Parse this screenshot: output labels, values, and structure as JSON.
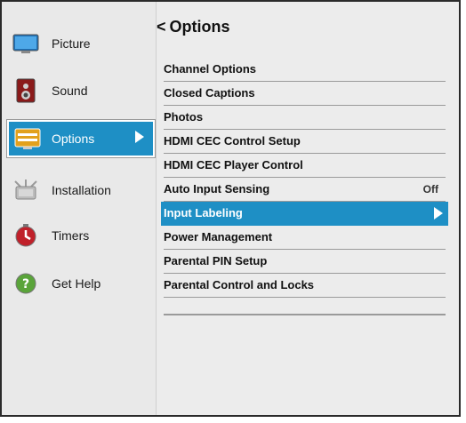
{
  "sidebar": {
    "items": [
      {
        "label": "Picture",
        "icon": "monitor-icon"
      },
      {
        "label": "Sound",
        "icon": "speaker-icon"
      },
      {
        "label": "Options",
        "icon": "options-icon"
      },
      {
        "label": "Installation",
        "icon": "antenna-icon"
      },
      {
        "label": "Timers",
        "icon": "timer-icon"
      },
      {
        "label": "Get Help",
        "icon": "help-icon"
      }
    ],
    "selected_index": 2
  },
  "main": {
    "back_glyph": "<",
    "title": "Options",
    "items": [
      {
        "label": "Channel Options"
      },
      {
        "label": "Closed Captions"
      },
      {
        "label": "Photos"
      },
      {
        "label": "HDMI CEC Control Setup"
      },
      {
        "label": "HDMI CEC Player Control"
      },
      {
        "label": "Auto Input Sensing",
        "value": "Off"
      },
      {
        "label": "Input Labeling"
      },
      {
        "label": "Power Management"
      },
      {
        "label": "Parental PIN Setup"
      },
      {
        "label": "Parental Control and Locks"
      }
    ],
    "selected_index": 6
  },
  "colors": {
    "accent": "#1e8fc5",
    "background": "#e9e9e9",
    "text": "#111111"
  }
}
